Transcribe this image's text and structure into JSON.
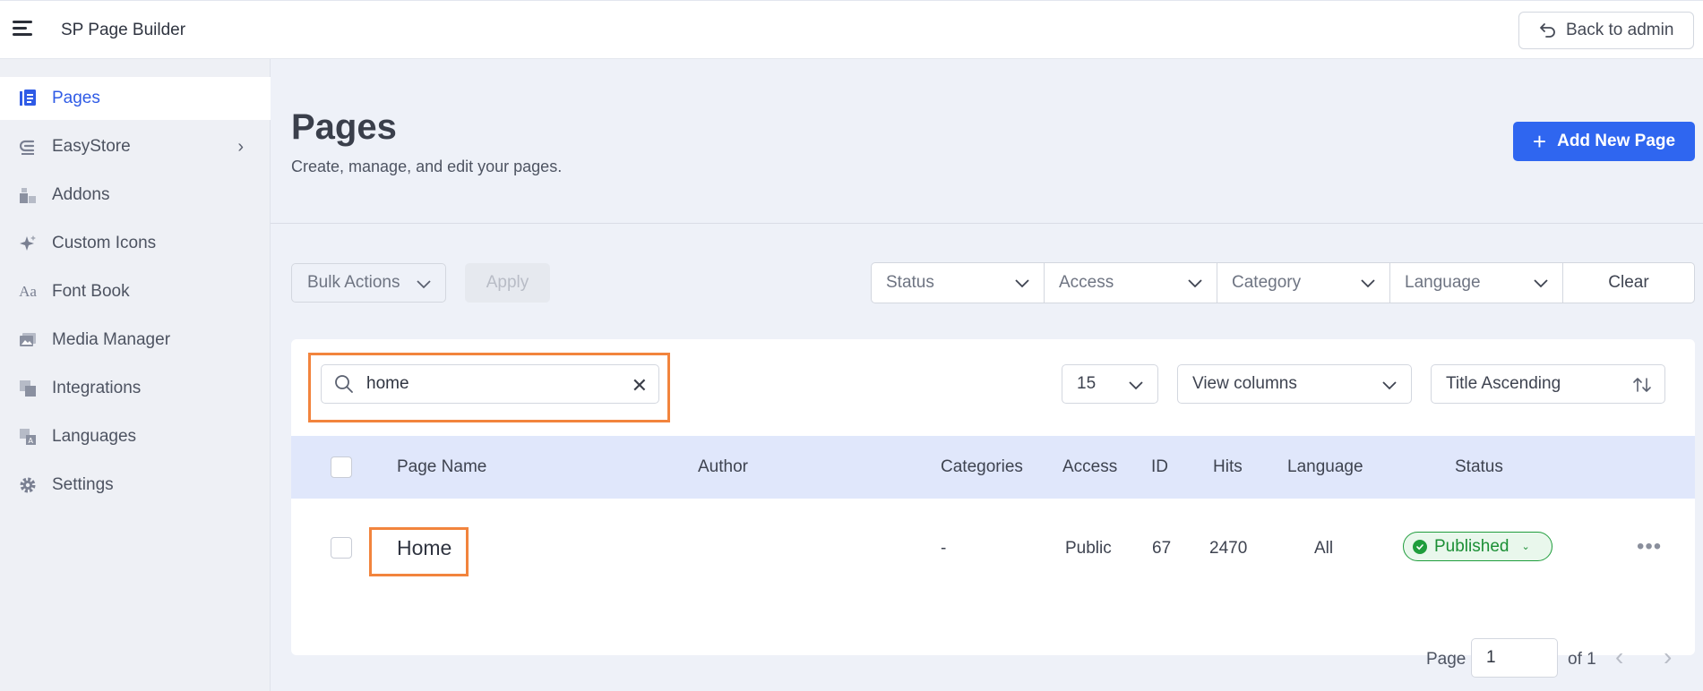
{
  "app": {
    "title": "SP Page Builder",
    "back_label": "Back to admin"
  },
  "sidebar": {
    "items": [
      {
        "label": "Pages",
        "icon": "pages-icon"
      },
      {
        "label": "EasyStore",
        "icon": "easystore-icon"
      },
      {
        "label": "Addons",
        "icon": "addons-icon"
      },
      {
        "label": "Custom Icons",
        "icon": "sparkle-icon"
      },
      {
        "label": "Font Book",
        "icon": "font-icon"
      },
      {
        "label": "Media Manager",
        "icon": "media-icon"
      },
      {
        "label": "Integrations",
        "icon": "integrations-icon"
      },
      {
        "label": "Languages",
        "icon": "languages-icon"
      },
      {
        "label": "Settings",
        "icon": "gear-icon"
      }
    ]
  },
  "header": {
    "title": "Pages",
    "subtitle": "Create, manage, and edit your pages.",
    "add_label": "Add New Page"
  },
  "toolbar": {
    "bulk_label": "Bulk Actions",
    "apply_label": "Apply",
    "filters": [
      "Status",
      "Access",
      "Category",
      "Language"
    ],
    "clear_label": "Clear"
  },
  "search": {
    "value": "home"
  },
  "listing": {
    "per_page": "15",
    "view_columns": "View columns",
    "sort": "Title Ascending"
  },
  "table": {
    "headers": {
      "name": "Page Name",
      "author": "Author",
      "categories": "Categories",
      "access": "Access",
      "id": "ID",
      "hits": "Hits",
      "language": "Language",
      "status": "Status"
    },
    "rows": [
      {
        "name": "Home",
        "author": "",
        "categories": "-",
        "access": "Public",
        "id": "67",
        "hits": "2470",
        "language": "All",
        "status": "Published"
      }
    ]
  },
  "pager": {
    "label": "Page",
    "current": "1",
    "of": "of 1"
  },
  "colors": {
    "accent": "#2f66f0",
    "active_nav": "#2f5be6",
    "highlight": "#f2843d",
    "published": "#1f9d3c",
    "table_header": "#e0e7fb"
  }
}
